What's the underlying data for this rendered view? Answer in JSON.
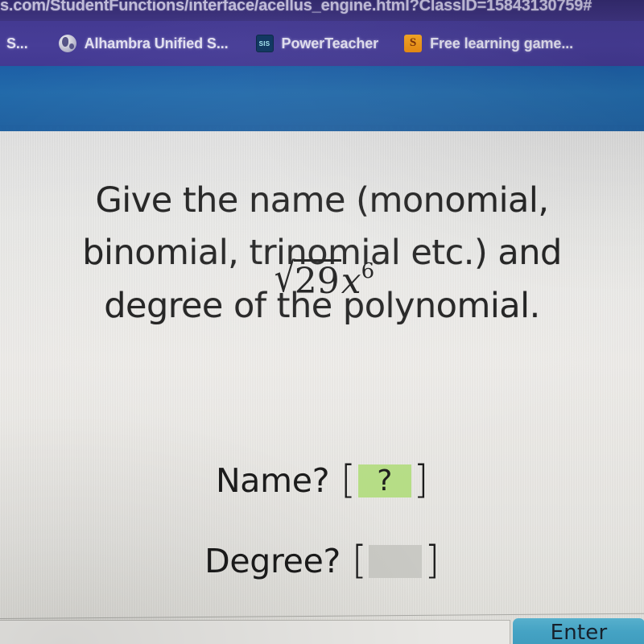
{
  "browser": {
    "url": "s.com/StudentFunctions/interface/acellus_engine.html?ClassID=15843130759#",
    "bookmarks": [
      {
        "label": "S...",
        "icon": "none"
      },
      {
        "label": "Alhambra Unified S...",
        "icon": "globe-icon"
      },
      {
        "label": "PowerTeacher",
        "icon": "sis-icon",
        "icon_text": "SIS"
      },
      {
        "label": "Free learning game...",
        "icon": "splashlearn-icon",
        "icon_text": "S"
      }
    ],
    "chrome_colors": {
      "url_bar": "#3a3078",
      "bookmarks_bar": "#473d97"
    }
  },
  "app": {
    "header_color": "#1e5f9f",
    "content_background": "#eceae7"
  },
  "question": {
    "line1": "Give the name (monomial,",
    "line2": "binomial, trinomial etc.) and",
    "line3": "degree of the polynomial."
  },
  "expression": {
    "radical_sign": "√",
    "radicand": "29",
    "variable": "x",
    "exponent": "6",
    "plain": "√29x⁶"
  },
  "answers": [
    {
      "label": "Name?",
      "open_bracket": "[",
      "close_bracket": "]",
      "value": "?",
      "state": "active",
      "highlight_color": "#b6dd86"
    },
    {
      "label": "Degree?",
      "open_bracket": "[",
      "close_bracket": "]",
      "value": "",
      "state": "empty",
      "highlight_color": "#c9c9c4"
    }
  ],
  "footer": {
    "answer_input_value": "",
    "answer_input_placeholder": "",
    "enter_label": "Enter",
    "enter_color": "#45a3c4"
  }
}
